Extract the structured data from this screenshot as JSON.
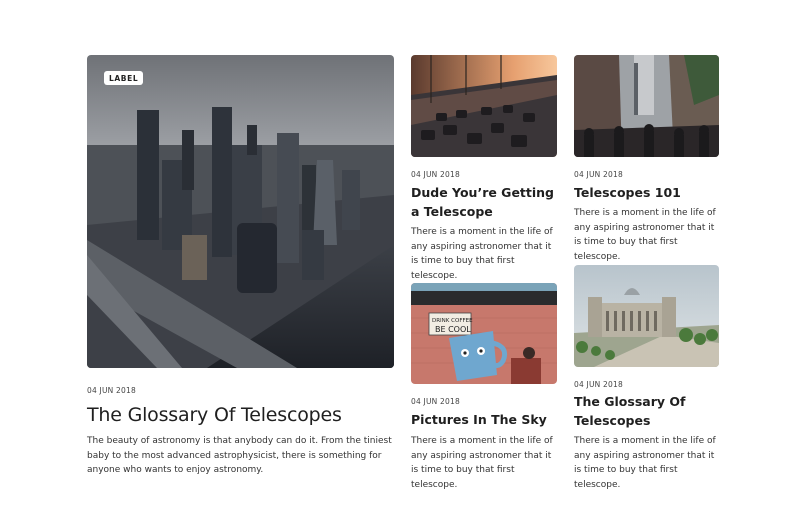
{
  "hero": {
    "label": "LABEL",
    "date": "04 JUN 2018",
    "title": "The Glossary Of Telescopes",
    "description": "The beauty of astronomy is that anybody can do it. From the tiniest baby to the most advanced astrophysicist, there is something for anyone who wants to enjoy astronomy."
  },
  "cards": [
    {
      "date": "04 JUN 2018",
      "title": "Dude You’re Getting a Telescope",
      "description": "There is a moment in the life of any aspiring astronomer that it is time to buy that first telescope."
    },
    {
      "date": "04 JUN 2018",
      "title": "Telescopes 101",
      "description": "There is a moment in the life of any aspiring astronomer that it is time to buy that first telescope."
    },
    {
      "date": "04 JUN 2018",
      "title": "Pictures In The Sky",
      "description": "There is a moment in the life of any aspiring astronomer that it is time to buy that first telescope.",
      "image_sign_line1": "DRINK COFFEE",
      "image_sign_line2": "BE COOL"
    },
    {
      "date": "04 JUN 2018",
      "title": "The Glossary Of Telescopes",
      "description": "There is a moment in the life of any aspiring astronomer that it is time to buy that first telescope."
    }
  ]
}
